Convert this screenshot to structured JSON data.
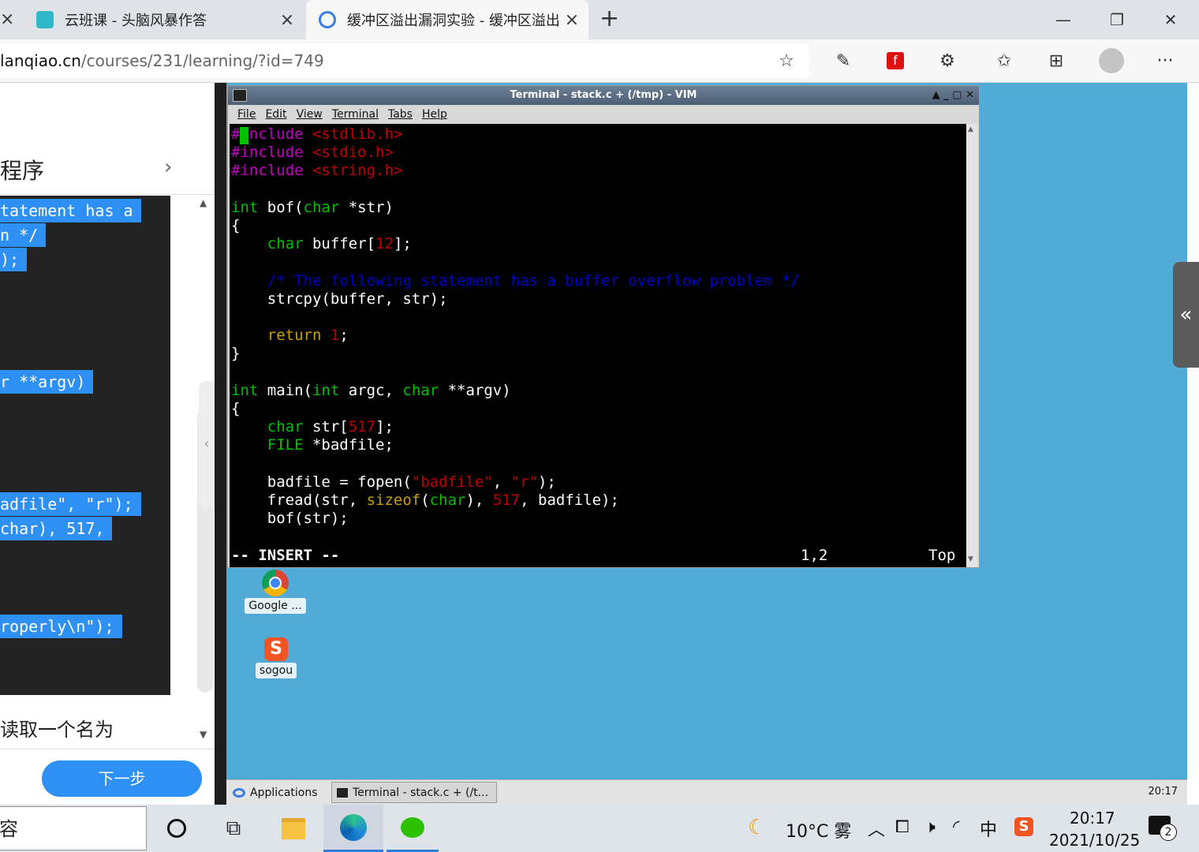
{
  "browser": {
    "tabs": [
      {
        "title": "云班课 - 头脑风暴作答",
        "close": "×"
      },
      {
        "title": "缓冲区溢出漏洞实验 - 缓冲区溢出",
        "close": "×"
      }
    ],
    "new_tab": "+",
    "url_host": "lanqiao.cn",
    "url_path": "/courses/231/learning/?id=749",
    "window_controls": {
      "minimize": "—",
      "maximize": "❐",
      "close": "✕"
    }
  },
  "left_panel": {
    "chapter_title": "程序",
    "chevron": "›",
    "selected_code_lines": [
      "tatement has a",
      "n */",
      ");",
      "r **argv)",
      "adfile\", \"r\");",
      "char), 517,",
      "roperly\\n\");"
    ],
    "description": "读取一个名为",
    "next_button": "下一步"
  },
  "terminal": {
    "title": "Terminal - stack.c + (/tmp) - VIM",
    "menu": [
      "File",
      "Edit",
      "View",
      "Terminal",
      "Tabs",
      "Help"
    ],
    "title_controls": "▲ _ ▢ ✕",
    "mode": "-- INSERT --",
    "position": "1,2",
    "scroll_pos": "Top",
    "code": {
      "include_kw": "#include",
      "inc1": "<stdlib.h>",
      "inc2": "<stdio.h>",
      "inc3": "<string.h>",
      "int": "int",
      "char": "char",
      "FILE": "FILE",
      "bof_sig": " bof(",
      "bof_sig_end": " *str)",
      "brace_open": "{",
      "brace_close": "}",
      "buffer_decl": " buffer[",
      "buffer_size": "12",
      "decl_end": "];",
      "comment": "/* The following statement has a buffer overflow problem */",
      "strcpy": "strcpy(buffer, str);",
      "return": "return",
      "return_val": "1",
      "semicolon": ";",
      "main_sig": " main(",
      "main_args1": " argc, ",
      "main_args2": " **argv)",
      "str_decl": " str[",
      "str_size": "517",
      "file_decl": " *badfile;",
      "fopen_pre": "badfile = fopen(",
      "fopen_arg1": "\"badfile\"",
      "comma": ", ",
      "fopen_arg2": "\"r\"",
      "fopen_end": ");",
      "fread_pre": "fread(str, ",
      "sizeof": "sizeof",
      "paren_open": "(",
      "fread_mid": "), ",
      "fread_num": "517",
      "fread_end": ", badfile);",
      "bof_call": "bof(str);"
    }
  },
  "desktop": {
    "icons": [
      {
        "label": "Google ...",
        "icon": "chrome-icon"
      },
      {
        "label": "sogou",
        "icon": "sogou-icon"
      }
    ],
    "taskbar": {
      "applications": "Applications",
      "task": "Terminal - stack.c + (/t...",
      "clock": "20:17"
    },
    "side_handle": "«"
  },
  "windows_taskbar": {
    "search_text": "容",
    "weather": "10°C 雾",
    "ime": "中",
    "time": "20:17",
    "date": "2021/10/25",
    "notification_count": "2"
  }
}
